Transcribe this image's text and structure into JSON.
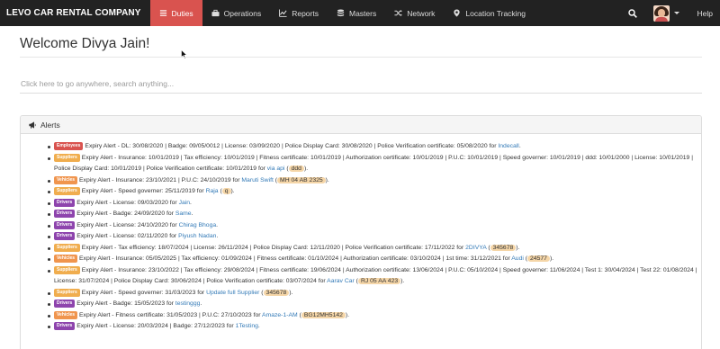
{
  "navbar": {
    "brand": "LEVO CAR RENTAL COMPANY",
    "items": [
      {
        "label": "Duties",
        "icon": "duties-icon",
        "active": true
      },
      {
        "label": "Operations",
        "icon": "operations-icon",
        "active": false
      },
      {
        "label": "Reports",
        "icon": "reports-icon",
        "active": false
      },
      {
        "label": "Masters",
        "icon": "masters-icon",
        "active": false
      },
      {
        "label": "Network",
        "icon": "network-icon",
        "active": false
      },
      {
        "label": "Location Tracking",
        "icon": "location-icon",
        "active": false
      }
    ],
    "help": "Help",
    "accent_color": "#d9534f",
    "bg_color": "#222222"
  },
  "welcome": "Welcome Divya Jain!",
  "search": {
    "placeholder": "Click here to go anywhere, search anything..."
  },
  "alerts": {
    "title": "Alerts",
    "items": [
      {
        "tag": "Employees",
        "text": "Expiry Alert - DL: 30/08/2020 | Badge: 09/05/0012 | License: 03/09/2020 | Police Display Card: 30/08/2020 | Police Verification certificate: 05/08/2020 for ",
        "link": "Indecall",
        "chip": "",
        "tail": "."
      },
      {
        "tag": "Suppliers",
        "text": "Expiry Alert - Insurance: 10/01/2019 | Tax efficiency: 10/01/2019 | Fitness certificate: 10/01/2019 | Authorization certificate: 10/01/2019 | P.U.C: 10/01/2019 | Speed governer: 10/01/2019 | ddd: 10/01/2000 | License: 10/01/2019 | Police Display Card: 10/01/2019 | Police Verification certificate: 10/01/2019 for ",
        "link": "via api",
        "chip": "ddd",
        "tail": "."
      },
      {
        "tag": "Vehicles",
        "text": "Expiry Alert - Insurance: 23/10/2021 | P.U.C: 24/10/2019 for ",
        "link": "Maruti Swift",
        "chip": "MH 04 AB 2325",
        "tail": "."
      },
      {
        "tag": "Suppliers",
        "text": "Expiry Alert - Speed governer: 25/11/2019 for ",
        "link": "Raja",
        "chip": "q",
        "tail": "."
      },
      {
        "tag": "Drivers",
        "text": "Expiry Alert - License: 09/03/2020 for ",
        "link": "Jain",
        "chip": "",
        "tail": "."
      },
      {
        "tag": "Drivers",
        "text": "Expiry Alert - Badge: 24/09/2020 for ",
        "link": "Same",
        "chip": "",
        "tail": "."
      },
      {
        "tag": "Drivers",
        "text": "Expiry Alert - License: 24/10/2020 for ",
        "link": "Chirag Bhoga",
        "chip": "",
        "tail": "."
      },
      {
        "tag": "Drivers",
        "text": "Expiry Alert - License: 02/11/2020 for ",
        "link": "Piyush Nadan",
        "chip": "",
        "tail": "."
      },
      {
        "tag": "Suppliers",
        "text": "Expiry Alert - Tax efficiency: 18/07/2024 | License: 26/11/2024 | Police Display Card: 12/11/2020 | Police Verification certificate: 17/11/2022 for ",
        "link": "2DIVYA",
        "chip": "345678",
        "tail": "."
      },
      {
        "tag": "Vehicles",
        "text": "Expiry Alert - Insurance: 05/05/2025 | Tax efficiency: 01/09/2024 | Fitness certificate: 01/10/2024 | Authorization certificate: 03/10/2024 | 1st time: 31/12/2021 for ",
        "link": "Audi",
        "chip": "24577",
        "tail": "."
      },
      {
        "tag": "Suppliers",
        "text": "Expiry Alert - Insurance: 23/10/2022 | Tax efficiency: 29/08/2024 | Fitness certificate: 19/06/2024 | Authorization certificate: 13/06/2024 | P.U.C: 05/10/2024 | Speed governer: 11/06/2024 | Test 1: 30/04/2024 | Test 22: 01/08/2024 | License: 31/07/2024 | Police Display Card: 30/06/2024 | Police Verification certificate: 03/07/2024 for ",
        "link": "Aarav Car",
        "chip": "RJ 05 AA 423",
        "tail": "."
      },
      {
        "tag": "Suppliers",
        "text": "Expiry Alert - Speed governer: 31/03/2023 for ",
        "link": "Update full Supplier",
        "chip": "345678",
        "tail": "."
      },
      {
        "tag": "Drivers",
        "text": "Expiry Alert - Badge: 15/05/2023 for ",
        "link": "testinggg",
        "chip": "",
        "tail": "."
      },
      {
        "tag": "Vehicles",
        "text": "Expiry Alert - Fitness certificate: 31/05/2023 | P.U.C: 27/10/2023 for ",
        "link": "Amaze-1-AM",
        "chip": "BG12MH5142",
        "tail": "."
      },
      {
        "tag": "Drivers",
        "text": "Expiry Alert - License: 20/03/2024 | Badge: 27/12/2023 for ",
        "link": "1Testing",
        "chip": "",
        "tail": "."
      }
    ]
  }
}
